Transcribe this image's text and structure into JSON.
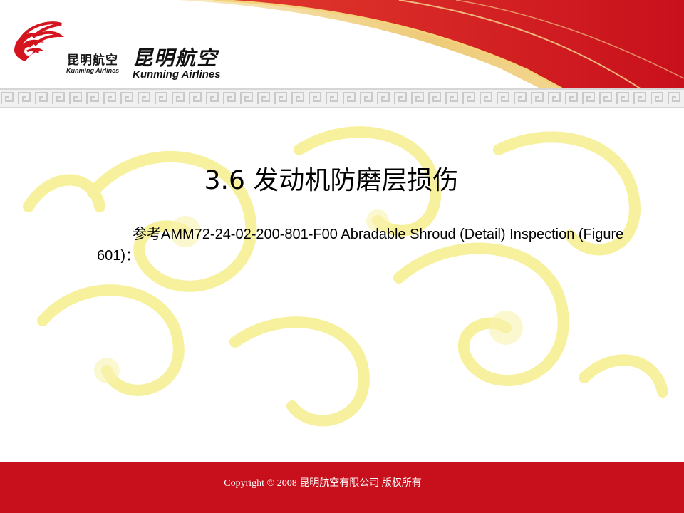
{
  "logo": {
    "small_cn": "昆明航空",
    "small_en": "Kunming Airlines",
    "big_cn": "昆明航空",
    "big_en": "Kunming Airlines"
  },
  "slide": {
    "title": "3.6 发动机防磨层损伤",
    "body": "参考AMM72-24-02-200-801-F00 Abradable Shroud (Detail) Inspection (Figure 601)："
  },
  "footer": {
    "copyright": "Copyright © 2008 昆明航空有限公司 版权所有"
  },
  "colors": {
    "brand_red": "#c8101c",
    "gold": "#e8b94a",
    "watermark_yellow": "#f6ef8e"
  }
}
